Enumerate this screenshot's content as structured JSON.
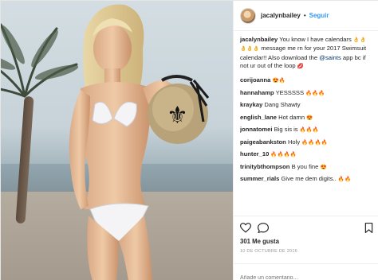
{
  "post": {
    "username": "jacalynbailey",
    "separator": "•",
    "follow_label": "Seguir",
    "caption": {
      "author": "jacalynbailey",
      "text_before": "You know I have calendars",
      "emoji_1": "👌👌👌👌👌",
      "text_mid": "message me rn for your 2017 Swimsuit calendar!! Also download the",
      "mention": "@saints",
      "text_after": "app bc if not ur out of the loop",
      "emoji_2": "💋"
    },
    "comments": [
      {
        "user": "corijoanna",
        "text": "",
        "emoji": "😍🔥"
      },
      {
        "user": "hannahamp",
        "text": "YESSSSS",
        "emoji": "🔥🔥🔥"
      },
      {
        "user": "kraykay",
        "text": "Dang Shawty",
        "emoji": ""
      },
      {
        "user": "english_lane",
        "text": "Hot damn",
        "emoji": "😍"
      },
      {
        "user": "jonnatomei",
        "text": "Big sis is",
        "emoji": "🔥🔥🔥"
      },
      {
        "user": "paigeabankston",
        "text": "Holy",
        "emoji": "🔥🔥🔥🔥"
      },
      {
        "user": "hunter_10",
        "text": "",
        "emoji": "🔥🔥🔥🔥"
      },
      {
        "user": "trinitybthompson",
        "text": "B you fine",
        "emoji": "😍"
      },
      {
        "user": "summer_rials",
        "text": "Give me dem digits..",
        "emoji": "🔥🔥"
      }
    ],
    "likes": "301 Me gusta",
    "date": "10 DE OCTUBRE DE 2016",
    "add_comment_placeholder": "Añade un comentario..."
  },
  "icons": {
    "like": "heart-icon",
    "comment": "comment-bubble-icon",
    "save": "bookmark-icon"
  },
  "colors": {
    "link": "#3897f0",
    "mention": "#003569",
    "muted": "#999999",
    "text": "#262626"
  }
}
